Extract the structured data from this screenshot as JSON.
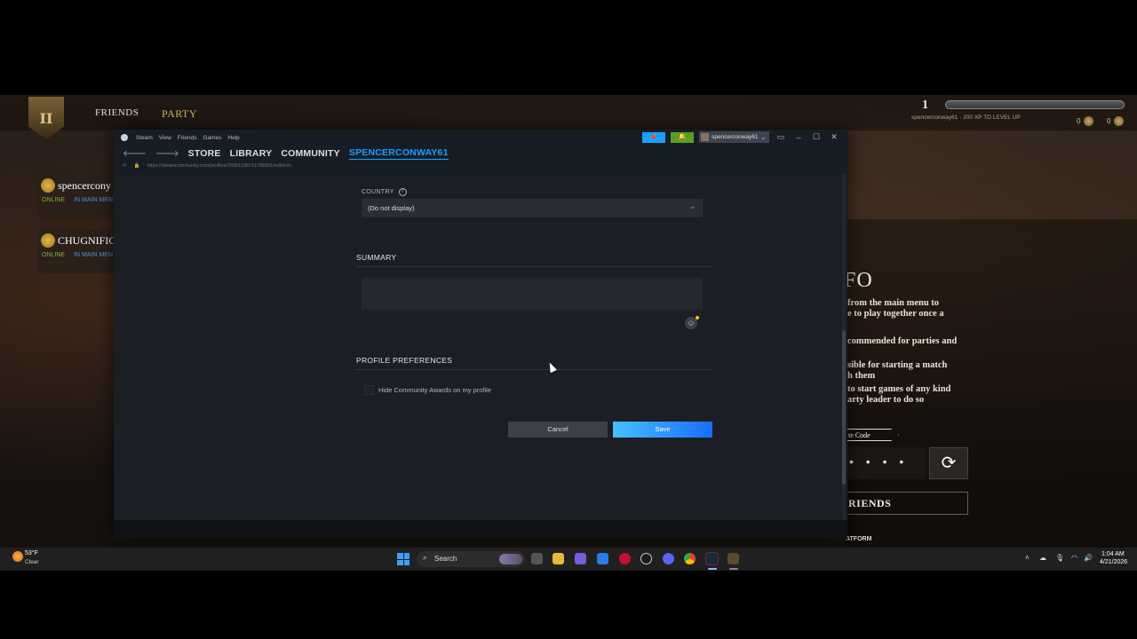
{
  "game": {
    "nav": {
      "friends": "FRIENDS",
      "party": "PARTY"
    },
    "logo": "II",
    "level": "1",
    "xp_line": "spencerconway61 · 200 XP TO LEVEL UP",
    "currency_a": "0",
    "currency_b": "0",
    "friends_list": [
      {
        "name": "spencercony",
        "online": "ONLINE",
        "location": "IN MAIN MEN"
      },
      {
        "name": "CHUGNIFICI",
        "online": "ONLINE",
        "location": "IN MAIN MEN"
      }
    ],
    "party_panel": {
      "title": "FO",
      "text_1": "from the main menu to\ne to play together once a",
      "text_2": "commended for parties and",
      "text_3": "sible for starting a match\nh them",
      "text_4": "to start games of any kind\narty leader to do so",
      "invite_code_label": "te Code",
      "code_value": "• • • •",
      "add_friends": "RIENDS",
      "platform": "ATFORM"
    }
  },
  "steam": {
    "menu": [
      "Steam",
      "View",
      "Friends",
      "Games",
      "Help"
    ],
    "tabs": {
      "store": "STORE",
      "library": "LIBRARY",
      "community": "COMMUNITY",
      "profile": "SPENCERCONWAY61"
    },
    "url": "https://steamcommunity.com/profiles/76561198711788891/edit/info",
    "account_name": "spencerconway61",
    "form": {
      "country_label": "COUNTRY",
      "country_value": "(Do not display)",
      "summary_title": "SUMMARY",
      "summary_value": "",
      "preferences_title": "PROFILE PREFERENCES",
      "hide_awards_label": "Hide Community Awards on my profile",
      "hide_awards_checked": false,
      "cancel_label": "Cancel",
      "save_label": "Save"
    }
  },
  "taskbar": {
    "weather_temp": "53°F",
    "weather_condition": "Clear",
    "search_label": "Search",
    "time": "1:04 AM",
    "date": "4/21/2026"
  },
  "colors": {
    "steam_accent": "#1a9fff",
    "steam_notify": "#5c9d28",
    "friend_online": "#7db33e",
    "friend_location": "#4d8fd8"
  }
}
